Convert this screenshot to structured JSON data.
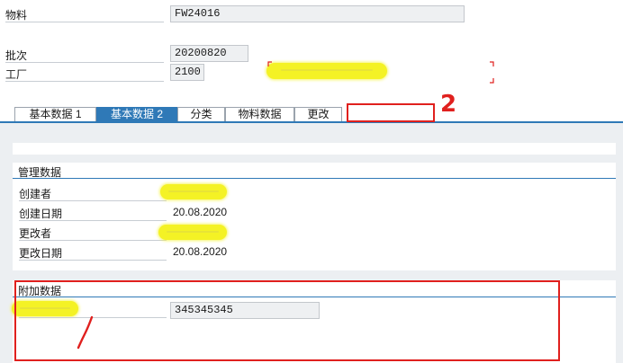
{
  "header": {
    "material_label": "物料",
    "material_value": "FW24016",
    "batch_label": "批次",
    "batch_value": "20200820",
    "plant_label": "工厂",
    "plant_value": "2100"
  },
  "tabs": [
    {
      "label": "基本数据 1",
      "active": false
    },
    {
      "label": "基本数据 2",
      "active": true
    },
    {
      "label": "分类",
      "active": false
    },
    {
      "label": "物料数据",
      "active": false
    },
    {
      "label": "更改",
      "active": false
    }
  ],
  "admin_group": {
    "title": "管理数据",
    "created_by_label": "创建者",
    "created_date_label": "创建日期",
    "created_date_value": "20.08.2020",
    "changed_by_label": "更改者",
    "changed_date_label": "更改日期",
    "changed_date_value": "20.08.2020"
  },
  "extra_group": {
    "title": "附加数据",
    "field_value": "345345345"
  },
  "annotations": {
    "mark_2": "2",
    "mark_1": "/"
  },
  "colors": {
    "accent": "#2f79b7",
    "annotation_red": "#e0201e",
    "highlighter_yellow": "#f3f000"
  }
}
